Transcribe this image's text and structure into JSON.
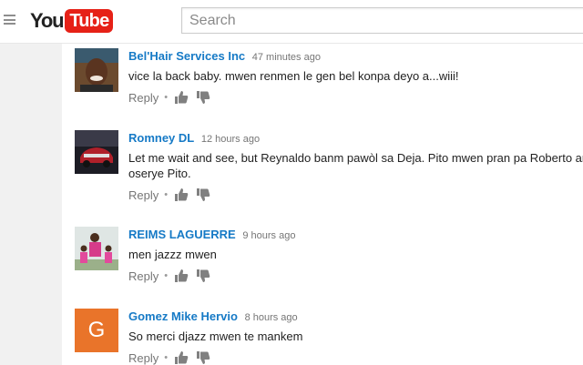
{
  "search": {
    "placeholder": "Search"
  },
  "logo": {
    "you": "You",
    "tube": "Tube"
  },
  "comments": [
    {
      "author": "Bel'Hair Services Inc",
      "time": "47 minutes ago",
      "text": "vice la back baby. mwen renmen le gen bel konpa deyo a...wiii!",
      "reply": "Reply",
      "avatar": "photo"
    },
    {
      "author": "Romney DL",
      "time": "12 hours ago",
      "text": "Let me wait and see, but Reynaldo banm pawòl sa Deja. Pito mwen pran pa Roberto an\noserye Pito.",
      "reply": "Reply",
      "avatar": "car-photo"
    },
    {
      "author": "REIMS LAGUERRE",
      "time": "9 hours ago",
      "text": "men jazzz mwen",
      "reply": "Reply",
      "avatar": "family-photo"
    },
    {
      "author": "Gomez Mike Hervio",
      "time": "8 hours ago",
      "text": "So merci djazz mwen te mankem",
      "reply": "Reply",
      "avatar_letter": "G"
    }
  ],
  "icons": {
    "like": "thumbs-up-icon",
    "dislike": "thumbs-down-icon",
    "menu": "hamburger-icon"
  },
  "colors": {
    "author": "#167ac6",
    "brand_red": "#e62117",
    "avatar_g": "#e9742a"
  }
}
